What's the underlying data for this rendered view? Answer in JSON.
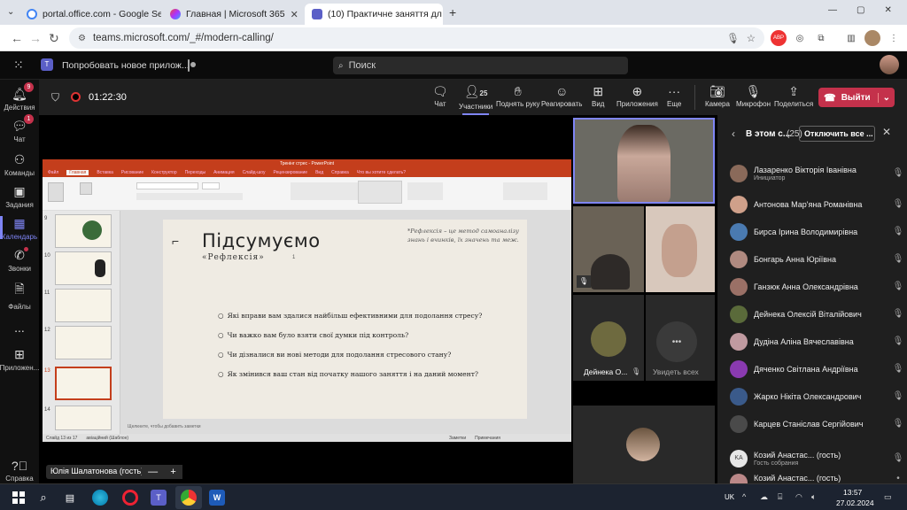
{
  "browser": {
    "tabs": [
      {
        "title": "portal.office.com - Google Sear",
        "close": "✕"
      },
      {
        "title": "Главная | Microsoft 365",
        "close": "✕"
      },
      {
        "title": "(10) Практичне заняття дл",
        "close": "✕"
      }
    ],
    "new_tab": "+",
    "url": "teams.microsoft.com/_#/modern-calling/",
    "window_controls": [
      "—",
      "▢",
      "✕"
    ]
  },
  "teams_top": {
    "try_new": "Попробовать новое прилож...",
    "search_placeholder": "Поиск"
  },
  "rail": [
    {
      "label": "Действия",
      "badge": "9",
      "icon": "bell-icon"
    },
    {
      "label": "Чат",
      "badge": "1",
      "icon": "chat-icon"
    },
    {
      "label": "Команды",
      "badge": "",
      "icon": "teams-icon"
    },
    {
      "label": "Задания",
      "badge": "",
      "icon": "assignments-icon"
    },
    {
      "label": "Календарь",
      "badge": "",
      "icon": "calendar-icon"
    },
    {
      "label": "Звонки",
      "badge": "",
      "icon": "phone-icon"
    },
    {
      "label": "Файлы",
      "badge": "",
      "icon": "files-icon"
    },
    {
      "label": "...",
      "badge": "",
      "icon": "more-icon"
    },
    {
      "label": "Приложен...",
      "badge": "",
      "icon": "apps-icon"
    },
    {
      "label": "Справка",
      "badge": "",
      "icon": "help-icon"
    }
  ],
  "meeting": {
    "timer": "01:22:30",
    "buttons": {
      "chat": "Чат",
      "participants": "Участники",
      "participants_count": "25",
      "raise_hand": "Поднять руку",
      "react": "Реагировать",
      "view": "Вид",
      "apps": "Приложения",
      "more": "Еще",
      "camera": "Камера",
      "mic": "Микрофон",
      "share": "Поделиться",
      "leave": "Выйти"
    }
  },
  "ppt": {
    "title": "Тренінг стрес - PowerPoint",
    "tabs": [
      "Файл",
      "Главная",
      "Вставка",
      "Рисование",
      "Конструктор",
      "Переходы",
      "Анимация",
      "Слайд-шоу",
      "Рецензирование",
      "Вид",
      "Справка",
      "Что вы хотите сделать?"
    ],
    "notes_placeholder": "Щелкните, чтобы добавить заметки",
    "status": [
      "Слайд 13 из 17",
      "авіаційний (Шаблон)",
      "Заметки",
      "Примечания"
    ],
    "thumb_numbers": [
      "9",
      "10",
      "11",
      "12",
      "13",
      "14"
    ],
    "slide": {
      "title": "Підсумуємо",
      "subtitle": "«Рефлексія»",
      "page_marker": "1",
      "quote": "*Рефлексія – це метод самоаналізу знань і вчинків, їх значень та меж.",
      "questions": [
        "Які вправи вам здалися найбільш ефективними для подолання стресу?",
        "Чи важко вам було взяти свої думки під контроль?",
        "Чи дізналися ви нові методи для подолання стресового стану?",
        "Як змінився ваш стан від початку нашого заняття і на даний момент?"
      ]
    }
  },
  "presenter": {
    "name": "Юлія Шалатонова (гость)",
    "minus": "—",
    "plus": "+"
  },
  "tiles": {
    "deineka_label": "Дейнека О...",
    "see_all": "Увидеть всех",
    "see_all_icon": "•••"
  },
  "panel": {
    "header": "В этом с...",
    "count": "(25)",
    "mute_all": "Отключить все ...",
    "participants": [
      {
        "name": "Лазаренко Вікторія Іванівна",
        "role": "Инициатор"
      },
      {
        "name": "Антонова Мар'яна Романівна",
        "role": ""
      },
      {
        "name": "Бирса Ірина Володимирівна",
        "role": ""
      },
      {
        "name": "Бонгарь Анна Юріївна",
        "role": ""
      },
      {
        "name": "Ганзюк Анна Олександрівна",
        "role": ""
      },
      {
        "name": "Дейнека Олексій Віталійович",
        "role": ""
      },
      {
        "name": "Дудіна Аліна Вячеславівна",
        "role": ""
      },
      {
        "name": "Дяченко Світлана Андріївна",
        "role": ""
      },
      {
        "name": "Жарко Нікіта Олександрович",
        "role": ""
      },
      {
        "name": "Карцев Станіслав Сергійович",
        "role": ""
      },
      {
        "name": "Козий Анастас... (гость)",
        "role": "Гость собрания",
        "initials": "KA"
      },
      {
        "name": "Козий Анастас... (гость)",
        "role": ""
      }
    ]
  },
  "taskbar": {
    "lang": "UK",
    "time": "13:57",
    "date": "27.02.2024"
  }
}
